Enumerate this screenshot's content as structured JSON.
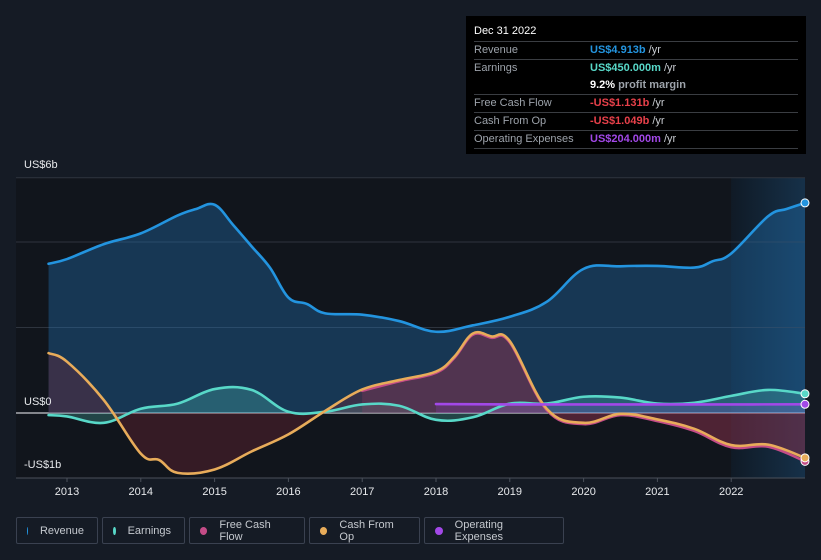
{
  "tooltip": {
    "date": "Dec 31 2022",
    "rows": [
      {
        "label": "Revenue",
        "value": "US$4.913b",
        "unit": "/yr",
        "color": "#2394df"
      },
      {
        "label": "Earnings",
        "value": "US$450.000m",
        "unit": "/yr",
        "color": "#58d8c8"
      },
      {
        "label": "",
        "value": "9.2%",
        "unit": "profit margin",
        "color": "#ffffff"
      },
      {
        "label": "Free Cash Flow",
        "value": "-US$1.131b",
        "unit": "/yr",
        "color": "#e8404a"
      },
      {
        "label": "Cash From Op",
        "value": "-US$1.049b",
        "unit": "/yr",
        "color": "#e8404a"
      },
      {
        "label": "Operating Expenses",
        "value": "US$204.000m",
        "unit": "/yr",
        "color": "#a248e8"
      }
    ]
  },
  "legend": [
    {
      "label": "Revenue",
      "color": "#2394df"
    },
    {
      "label": "Earnings",
      "color": "#58d8c8"
    },
    {
      "label": "Free Cash Flow",
      "color": "#c44c87"
    },
    {
      "label": "Cash From Op",
      "color": "#e8ac5a"
    },
    {
      "label": "Operating Expenses",
      "color": "#a248e8"
    }
  ],
  "chart_data": {
    "type": "area",
    "title": "",
    "xlabel": "",
    "ylabel": "",
    "unit": "US$ billions",
    "y_labels": [
      "US$6b",
      "US$0",
      "-US$1b"
    ],
    "y_label_values": [
      5.5,
      0,
      -1.5
    ],
    "ylim": [
      -1.52,
      5.5
    ],
    "xlim": [
      2012.5,
      2023.0
    ],
    "x_ticks": [
      2013,
      2014,
      2015,
      2016,
      2017,
      2018,
      2019,
      2020,
      2021,
      2022
    ],
    "gridlines_y": [
      5.5,
      4.0,
      2.0,
      0,
      -1.52
    ],
    "highlight_from": 2022,
    "series": [
      {
        "name": "Revenue",
        "color": "#2394df",
        "points": [
          [
            2012.75,
            3.49
          ],
          [
            2013,
            3.6
          ],
          [
            2013.5,
            3.95
          ],
          [
            2014,
            4.2
          ],
          [
            2014.5,
            4.62
          ],
          [
            2014.75,
            4.77
          ],
          [
            2015,
            4.87
          ],
          [
            2015.25,
            4.4
          ],
          [
            2015.5,
            3.9
          ],
          [
            2015.75,
            3.4
          ],
          [
            2016,
            2.7
          ],
          [
            2016.25,
            2.55
          ],
          [
            2016.5,
            2.33
          ],
          [
            2017,
            2.3
          ],
          [
            2017.5,
            2.15
          ],
          [
            2018,
            1.9
          ],
          [
            2018.5,
            2.05
          ],
          [
            2019,
            2.25
          ],
          [
            2019.5,
            2.6
          ],
          [
            2020,
            3.37
          ],
          [
            2020.5,
            3.43
          ],
          [
            2021,
            3.44
          ],
          [
            2021.5,
            3.4
          ],
          [
            2021.75,
            3.55
          ],
          [
            2022,
            3.73
          ],
          [
            2022.5,
            4.6
          ],
          [
            2022.75,
            4.77
          ],
          [
            2023,
            4.913
          ]
        ]
      },
      {
        "name": "Earnings",
        "color": "#58d8c8",
        "points": [
          [
            2012.75,
            -0.05
          ],
          [
            2013,
            -0.08
          ],
          [
            2013.5,
            -0.23
          ],
          [
            2014,
            0.1
          ],
          [
            2014.5,
            0.22
          ],
          [
            2015,
            0.56
          ],
          [
            2015.5,
            0.54
          ],
          [
            2016,
            0.03
          ],
          [
            2016.5,
            0.03
          ],
          [
            2017,
            0.2
          ],
          [
            2017.5,
            0.17
          ],
          [
            2018,
            -0.16
          ],
          [
            2018.5,
            -0.1
          ],
          [
            2019,
            0.22
          ],
          [
            2019.5,
            0.22
          ],
          [
            2020,
            0.38
          ],
          [
            2020.5,
            0.36
          ],
          [
            2021,
            0.22
          ],
          [
            2021.5,
            0.24
          ],
          [
            2022,
            0.4
          ],
          [
            2022.5,
            0.54
          ],
          [
            2023,
            0.45
          ]
        ]
      },
      {
        "name": "Free Cash Flow",
        "color": "#c44c87",
        "points": [
          [
            2017,
            0.52
          ],
          [
            2017.5,
            0.74
          ],
          [
            2018,
            0.94
          ],
          [
            2018.25,
            1.29
          ],
          [
            2018.5,
            1.83
          ],
          [
            2018.75,
            1.76
          ],
          [
            2019,
            1.65
          ],
          [
            2019.5,
            0.07
          ],
          [
            2020,
            -0.26
          ],
          [
            2020.5,
            -0.05
          ],
          [
            2021,
            -0.19
          ],
          [
            2021.5,
            -0.42
          ],
          [
            2022,
            -0.8
          ],
          [
            2022.5,
            -0.79
          ],
          [
            2023,
            -1.131
          ]
        ]
      },
      {
        "name": "Cash From Op",
        "color": "#e8ac5a",
        "points": [
          [
            2012.75,
            1.4
          ],
          [
            2013,
            1.2
          ],
          [
            2013.5,
            0.3
          ],
          [
            2014,
            -0.95
          ],
          [
            2014.25,
            -1.1
          ],
          [
            2014.5,
            -1.4
          ],
          [
            2015,
            -1.32
          ],
          [
            2015.5,
            -0.9
          ],
          [
            2016,
            -0.5
          ],
          [
            2016.5,
            0.05
          ],
          [
            2017,
            0.55
          ],
          [
            2017.5,
            0.77
          ],
          [
            2018,
            0.97
          ],
          [
            2018.25,
            1.32
          ],
          [
            2018.5,
            1.86
          ],
          [
            2018.75,
            1.79
          ],
          [
            2019,
            1.68
          ],
          [
            2019.5,
            0.1
          ],
          [
            2020,
            -0.23
          ],
          [
            2020.5,
            -0.02
          ],
          [
            2021,
            -0.15
          ],
          [
            2021.5,
            -0.37
          ],
          [
            2022,
            -0.75
          ],
          [
            2022.5,
            -0.74
          ],
          [
            2023,
            -1.049
          ]
        ]
      },
      {
        "name": "Operating Expenses",
        "color": "#a248e8",
        "points": [
          [
            2018,
            0.21
          ],
          [
            2019,
            0.2
          ],
          [
            2020,
            0.2
          ],
          [
            2021,
            0.2
          ],
          [
            2022,
            0.2
          ],
          [
            2023,
            0.204
          ]
        ]
      }
    ]
  }
}
